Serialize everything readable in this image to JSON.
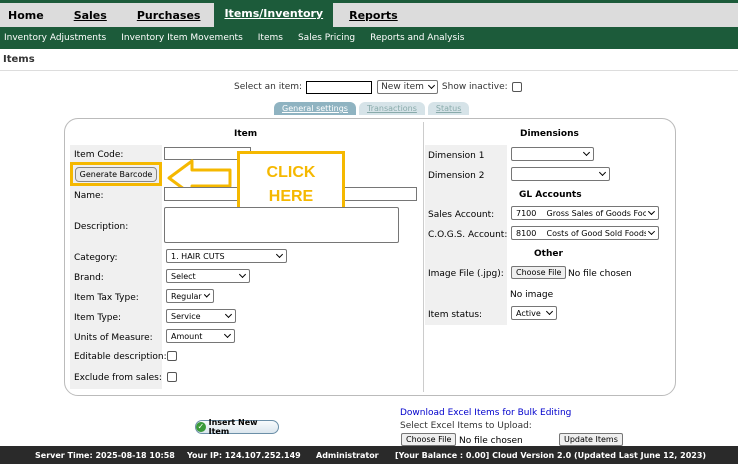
{
  "topnav": {
    "tabs": [
      {
        "label": "Home"
      },
      {
        "label": "Sales"
      },
      {
        "label": "Purchases"
      },
      {
        "label": "Items/Inventory"
      },
      {
        "label": "Reports"
      }
    ]
  },
  "subnav": {
    "items": [
      "Inventory Adjustments",
      "Inventory Item Movements",
      "Items",
      "Sales Pricing",
      "Reports and Analysis"
    ]
  },
  "page_title": "Items",
  "selector": {
    "select_label": "Select an item:",
    "new_item": "New item",
    "show_inactive": "Show inactive:"
  },
  "tabs": [
    "General settings",
    "Transactions",
    "Status"
  ],
  "item": {
    "header": "Item",
    "item_code_label": "Item Code:",
    "generate_barcode": "Generate Barcode",
    "name_label": "Name:",
    "description_label": "Description:",
    "category_label": "Category:",
    "category_value": "1. HAIR CUTS",
    "brand_label": "Brand:",
    "brand_value": "Select",
    "tax_label": "Item Tax Type:",
    "tax_value": "Regular",
    "type_label": "Item Type:",
    "type_value": "Service",
    "uom_label": "Units of Measure:",
    "uom_value": "Amount",
    "editable_label": "Editable description:",
    "exclude_label": "Exclude from sales:"
  },
  "dimensions": {
    "header": "Dimensions",
    "dim1_label": "Dimension 1",
    "dim2_label": "Dimension 2"
  },
  "gl": {
    "header": "GL Accounts",
    "sales_label": "Sales Account:",
    "sales_value": "7100    Gross Sales of Goods Foods",
    "cogs_label": "C.O.G.S. Account:",
    "cogs_value": "8100    Costs of Good Sold Foods"
  },
  "other": {
    "header": "Other",
    "image_label": "Image File (.jpg):",
    "choose_file": "Choose File",
    "no_file": "No file chosen",
    "no_image": "No image",
    "status_label": "Item status:",
    "status_value": "Active"
  },
  "callout": {
    "line1": "CLICK",
    "line2": "HERE",
    "color": "#f5b800"
  },
  "bottom": {
    "insert_button": "Insert New Item",
    "download_link": "Download Excel Items for Bulk Editing",
    "select_excel": "Select Excel Items to Upload:",
    "choose_file": "Choose File",
    "no_file": "No file chosen",
    "update_items": "Update Items"
  },
  "footer": {
    "server_time": "Server Time: 2025-08-18 10:58",
    "ip": "Your IP: 124.107.252.149",
    "user": "Administrator",
    "balance": "[Your Balance : 0.00] Cloud Version 2.0 (Updated Last June 12, 2023)"
  },
  "colors": {
    "brand_green": "#1c5b3a",
    "highlight": "#f5b800"
  }
}
